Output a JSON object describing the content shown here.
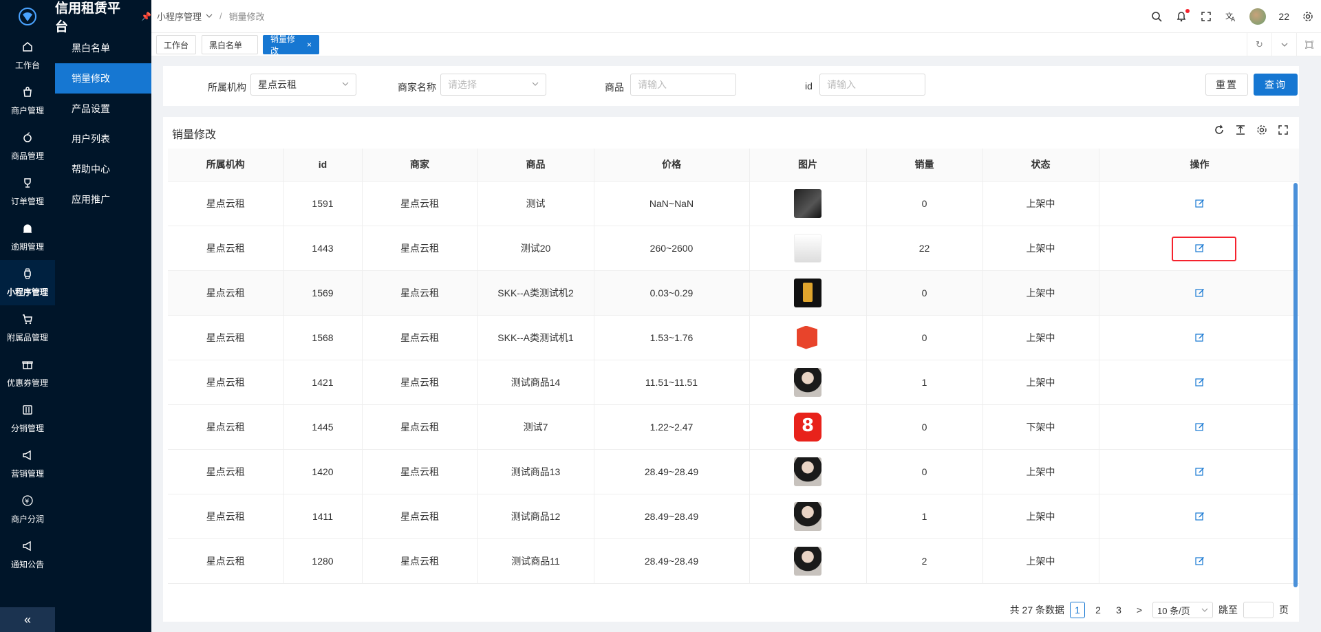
{
  "app": {
    "title": "信用租赁平台"
  },
  "rail": {
    "items": [
      {
        "label": "工作台",
        "icon": "home-icon"
      },
      {
        "label": "商户管理",
        "icon": "shop-icon"
      },
      {
        "label": "商品管理",
        "icon": "apple-icon"
      },
      {
        "label": "订单管理",
        "icon": "trophy-icon"
      },
      {
        "label": "逾期管理",
        "icon": "alarm-icon"
      },
      {
        "label": "小程序管理",
        "icon": "watch-icon",
        "active": true
      },
      {
        "label": "附属品管理",
        "icon": "cart-icon"
      },
      {
        "label": "优惠券管理",
        "icon": "gift-icon"
      },
      {
        "label": "分销管理",
        "icon": "sliders-icon"
      },
      {
        "label": "营销管理",
        "icon": "megaphone-icon"
      },
      {
        "label": "商户分润",
        "icon": "yen-icon"
      },
      {
        "label": "通知公告",
        "icon": "notice-icon"
      }
    ],
    "collapse": "«"
  },
  "subnav": {
    "items": [
      "黑白名单",
      "销量修改",
      "产品设置",
      "用户列表",
      "帮助中心",
      "应用推广"
    ],
    "active": 1
  },
  "header": {
    "breadcrumb": [
      "小程序管理",
      "销量修改"
    ],
    "user": "22"
  },
  "tabs": [
    {
      "label": "工作台"
    },
    {
      "label": "黑白名单"
    },
    {
      "label": "销量修改",
      "active": true,
      "close": "×"
    }
  ],
  "filter": {
    "org_label": "所属机构",
    "org_value": "星点云租",
    "merchant_label": "商家名称",
    "merchant_placeholder": "请选择",
    "product_label": "商品",
    "product_placeholder": "请输入",
    "id_label": "id",
    "id_placeholder": "请输入",
    "reset": "重置",
    "query": "查询"
  },
  "table": {
    "title": "销量修改",
    "columns": [
      "所属机构",
      "id",
      "商家",
      "商品",
      "价格",
      "图片",
      "销量",
      "状态",
      "操作"
    ],
    "rows": [
      {
        "org": "星点云租",
        "id": "1591",
        "merchant": "星点云租",
        "product": "测试",
        "price": "NaN~NaN",
        "img": "th-dark",
        "sales": "0",
        "status": "上架中"
      },
      {
        "org": "星点云租",
        "id": "1443",
        "merchant": "星点云租",
        "product": "测试20",
        "price": "260~2600",
        "img": "th-phone",
        "sales": "22",
        "status": "上架中"
      },
      {
        "org": "星点云租",
        "id": "1569",
        "merchant": "星点云租",
        "product": "SKK--A类测试机2",
        "price": "0.03~0.29",
        "img": "th-gold",
        "sales": "0",
        "status": "上架中"
      },
      {
        "org": "星点云租",
        "id": "1568",
        "merchant": "星点云租",
        "product": "SKK--A类测试机1",
        "price": "1.53~1.76",
        "img": "th-red",
        "sales": "0",
        "status": "上架中"
      },
      {
        "org": "星点云租",
        "id": "1421",
        "merchant": "星点云租",
        "product": "测试商品14",
        "price": "11.51~11.51",
        "img": "th-girl",
        "sales": "1",
        "status": "上架中"
      },
      {
        "org": "星点云租",
        "id": "1445",
        "merchant": "星点云租",
        "product": "测试7",
        "price": "1.22~2.47",
        "img": "th-app",
        "sales": "0",
        "status": "下架中"
      },
      {
        "org": "星点云租",
        "id": "1420",
        "merchant": "星点云租",
        "product": "测试商品13",
        "price": "28.49~28.49",
        "img": "th-girl",
        "sales": "0",
        "status": "上架中"
      },
      {
        "org": "星点云租",
        "id": "1411",
        "merchant": "星点云租",
        "product": "测试商品12",
        "price": "28.49~28.49",
        "img": "th-girl",
        "sales": "1",
        "status": "上架中"
      },
      {
        "org": "星点云租",
        "id": "1280",
        "merchant": "星点云租",
        "product": "测试商品11",
        "price": "28.49~28.49",
        "img": "th-girl",
        "sales": "2",
        "status": "上架中"
      }
    ]
  },
  "pager": {
    "total": "共 27 条数据",
    "pages": [
      "1",
      "2",
      "3"
    ],
    "current": "1",
    "next": ">",
    "size": "10 条/页",
    "jump_label": "跳至",
    "jump_suffix": "页"
  }
}
